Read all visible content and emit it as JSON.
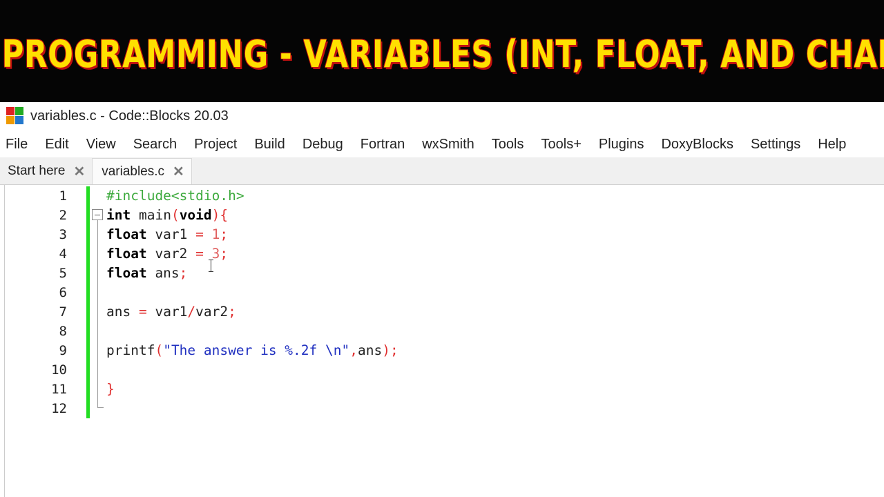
{
  "banner": {
    "title": "C PROGRAMMING - VARIABLES (INT, FLOAT, AND CHAR)"
  },
  "window": {
    "title": "variables.c - Code::Blocks 20.03",
    "icon": "codeblocks-icon"
  },
  "menu": {
    "items": [
      "File",
      "Edit",
      "View",
      "Search",
      "Project",
      "Build",
      "Debug",
      "Fortran",
      "wxSmith",
      "Tools",
      "Tools+",
      "Plugins",
      "DoxyBlocks",
      "Settings",
      "Help"
    ]
  },
  "tabs": [
    {
      "label": "Start here",
      "close": "✕"
    },
    {
      "label": "variables.c",
      "close": "✕"
    }
  ],
  "editor": {
    "line_numbers": [
      "1",
      "2",
      "3",
      "4",
      "5",
      "6",
      "7",
      "8",
      "9",
      "10",
      "11",
      "12"
    ],
    "code": {
      "l1": "#include<stdio.h>",
      "l2_kw1": "int",
      "l2_fn": " main",
      "l2_p1": "(",
      "l2_kw2": "void",
      "l2_p2": "){",
      "l3_kw": "float",
      "l3_id": " var1 ",
      "l3_op": "=",
      "l3_sp": " ",
      "l3_num": "1",
      "l3_end": ";",
      "l4_kw": "float",
      "l4_id": " var2 ",
      "l4_op": "=",
      "l4_sp": " ",
      "l4_num": "3",
      "l4_end": ";",
      "l5_kw": "float",
      "l5_id": " ans",
      "l5_end": ";",
      "l7_id1": "ans ",
      "l7_op1": "=",
      "l7_id2": " var1",
      "l7_op2": "/",
      "l7_id3": "var2",
      "l7_end": ";",
      "l9_fn": "printf",
      "l9_p1": "(",
      "l9_str": "\"The answer is %.2f \\n\"",
      "l9_comma": ",",
      "l9_id": "ans",
      "l9_end": ");",
      "l11": "}"
    }
  },
  "colors": {
    "banner_text": "#ffe000",
    "change_bar": "#22dd22",
    "preprocessor": "#3daa3d",
    "operator": "#e03030",
    "string": "#2030c0"
  }
}
